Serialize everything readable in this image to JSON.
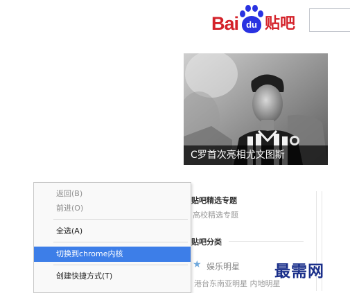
{
  "header": {
    "logo_text_latin": "Bai",
    "logo_paw_text": "du",
    "logo_text_cn": "贴吧"
  },
  "banner": {
    "caption": "C罗首次亮相尤文图斯"
  },
  "sidebar": {
    "featured_title": "贴吧精选专题",
    "featured_item": "高校精选专题",
    "category_title": "贴吧分类",
    "category_item": "娱乐明星",
    "sub_items": "港台东南亚明星  内地明星"
  },
  "context_menu": {
    "items": [
      {
        "label": "返回(B)",
        "state": "disabled"
      },
      {
        "label": "前进(O)",
        "state": "disabled"
      },
      {
        "label": "全选(A)",
        "state": "normal"
      },
      {
        "label": "切换到chrome内核",
        "state": "highlighted"
      },
      {
        "label": "创建快捷方式(T)",
        "state": "normal"
      }
    ]
  },
  "watermark": "最需网",
  "colors": {
    "highlight": "#3d7ee8",
    "baidu_red": "#d4222a",
    "baidu_blue": "#2932e1"
  }
}
